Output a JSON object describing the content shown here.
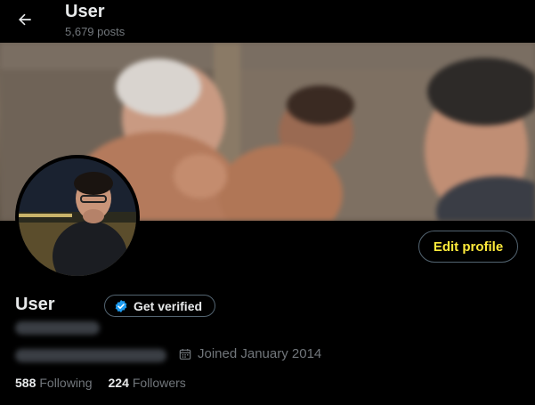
{
  "header": {
    "title": "User",
    "posts_count": "5,679 posts"
  },
  "profile": {
    "name": "User",
    "edit_label": "Edit profile",
    "verified_label": "Get verified",
    "joined": "Joined January 2014",
    "following_count": "588",
    "following_label": "Following",
    "followers_count": "224",
    "followers_label": "Followers"
  },
  "colors": {
    "background": "#000000",
    "text_primary": "#e7e9ea",
    "text_secondary": "#71767b",
    "border": "#536471",
    "verified_blue": "#1d9bf0",
    "edit_profile_text": "#ffeb3b"
  },
  "icons": {
    "back": "arrow-left-icon",
    "verified": "verified-badge-icon",
    "calendar": "calendar-icon"
  }
}
